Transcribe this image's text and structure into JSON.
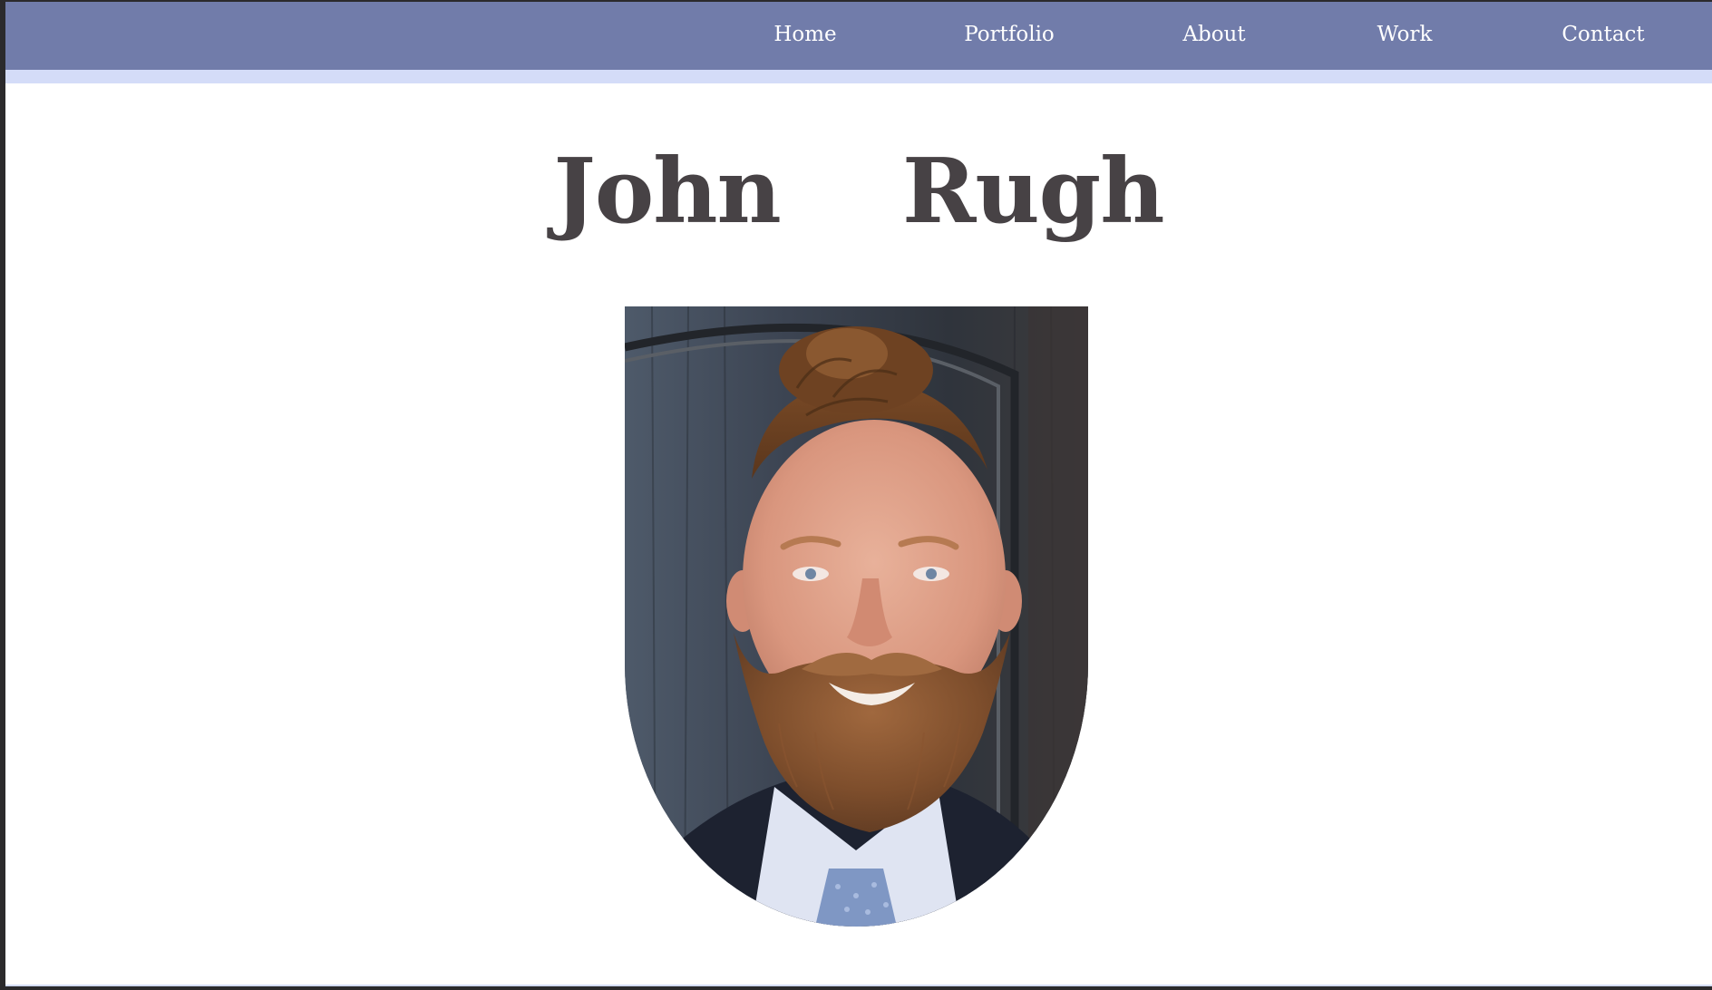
{
  "nav": {
    "links": [
      {
        "label": "Home"
      },
      {
        "label": "Portfolio"
      },
      {
        "label": "About"
      },
      {
        "label": "Work"
      },
      {
        "label": "Contact"
      }
    ]
  },
  "hero": {
    "name": "John  Rugh"
  },
  "colors": {
    "navbar": "#717caa",
    "nav_accent": "#d4dcf8",
    "title_text": "#474245",
    "page_background": "#ffffff"
  }
}
